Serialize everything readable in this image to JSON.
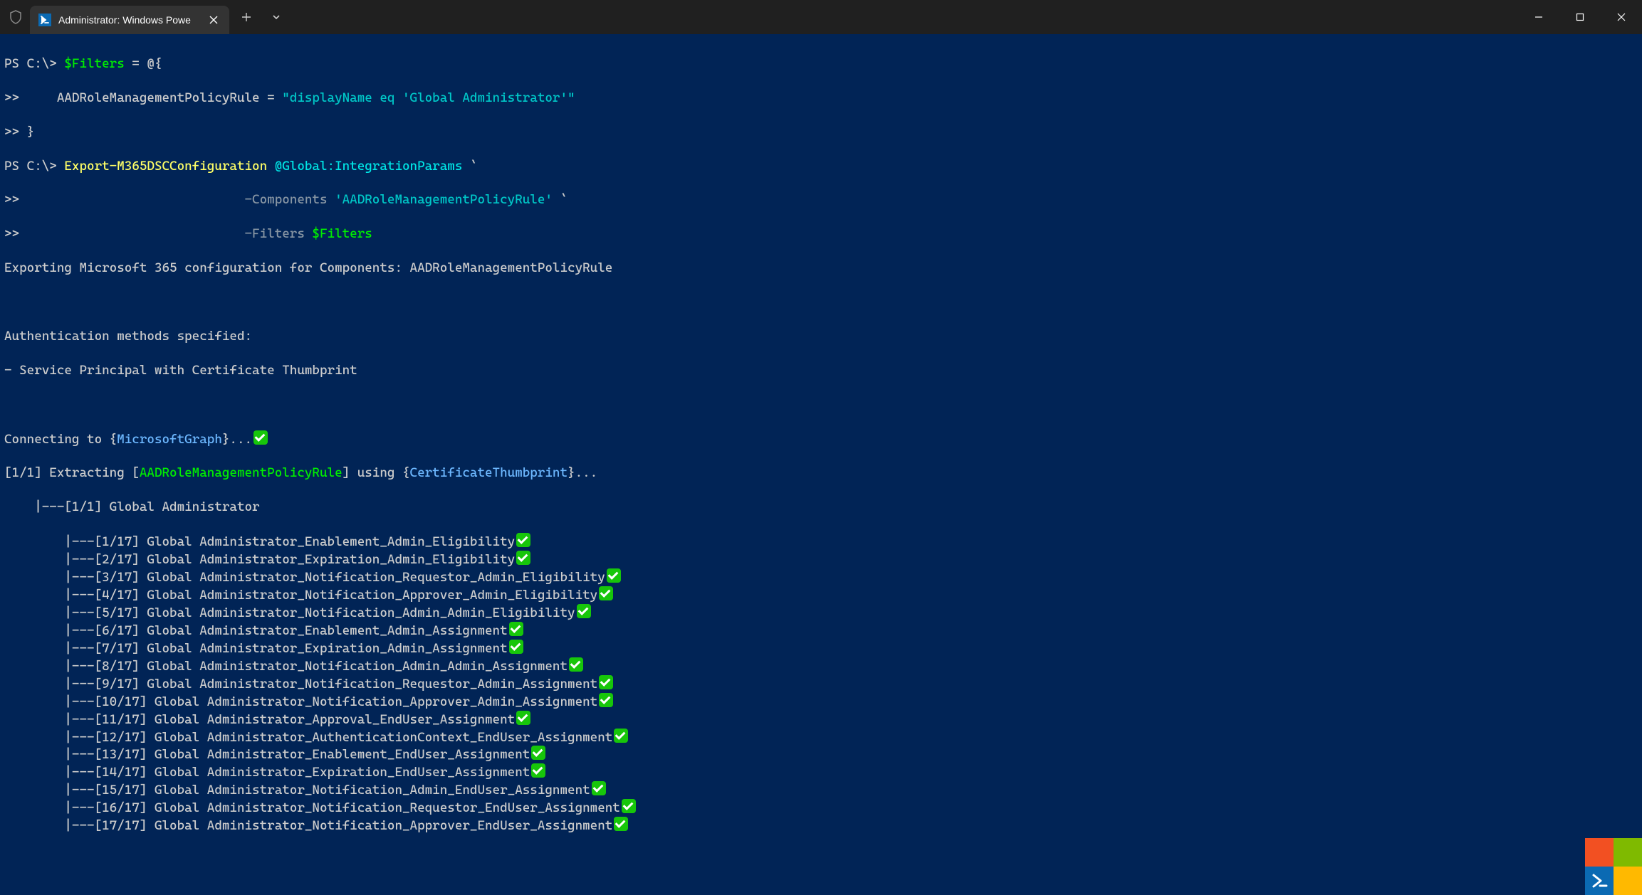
{
  "window": {
    "tab_title": "Administrator: Windows Powe",
    "shield_icon": "shield",
    "ps_icon": ">_"
  },
  "cmd": {
    "p1_prompt": "PS C:\\> ",
    "p1_var": "$Filters",
    "p1_rest": " = @{",
    "p2_prefix": ">>     ",
    "p2_key": "AADRoleManagementPolicyRule",
    "p2_eq": " = ",
    "p2_val": "\"displayName eq 'Global Administrator'\"",
    "p3": ">> }",
    "p4_prompt": "PS C:\\> ",
    "p4_cmd": "Export-M365DSCConfiguration",
    "p4_splat": " @Global:IntegrationParams",
    "p4_tick": " `",
    "p5_prefix": ">>                              ",
    "p5_param": "-Components",
    "p5_val": " 'AADRoleManagementPolicyRule'",
    "p5_tick": " `",
    "p6_prefix": ">>                              ",
    "p6_param": "-Filters",
    "p6_var": " $Filters"
  },
  "out": {
    "l1": "Exporting Microsoft 365 configuration for Components: AADRoleManagementPolicyRule",
    "l2": "Authentication methods specified:",
    "l3": "- Service Principal with Certificate Thumbprint",
    "conn_pre": "Connecting to {",
    "conn_svc": "MicrosoftGraph",
    "conn_post": "}...",
    "ext_1": "[1/1] Extracting [",
    "ext_comp": "AADRoleManagementPolicyRule",
    "ext_2": "] using {",
    "ext_auth": "CertificateThumbprint",
    "ext_3": "}...",
    "role_line": "    |---[1/1] Global Administrator",
    "rules": [
      "        |---[1/17] Global Administrator_Enablement_Admin_Eligibility",
      "        |---[2/17] Global Administrator_Expiration_Admin_Eligibility",
      "        |---[3/17] Global Administrator_Notification_Requestor_Admin_Eligibility",
      "        |---[4/17] Global Administrator_Notification_Approver_Admin_Eligibility",
      "        |---[5/17] Global Administrator_Notification_Admin_Admin_Eligibility",
      "        |---[6/17] Global Administrator_Enablement_Admin_Assignment",
      "        |---[7/17] Global Administrator_Expiration_Admin_Assignment",
      "        |---[8/17] Global Administrator_Notification_Admin_Admin_Assignment",
      "        |---[9/17] Global Administrator_Notification_Requestor_Admin_Assignment",
      "        |---[10/17] Global Administrator_Notification_Approver_Admin_Assignment",
      "        |---[11/17] Global Administrator_Approval_EndUser_Assignment",
      "        |---[12/17] Global Administrator_AuthenticationContext_EndUser_Assignment",
      "        |---[13/17] Global Administrator_Enablement_EndUser_Assignment",
      "        |---[14/17] Global Administrator_Expiration_EndUser_Assignment",
      "        |---[15/17] Global Administrator_Notification_Admin_EndUser_Assignment",
      "        |---[16/17] Global Administrator_Notification_Requestor_EndUser_Assignment",
      "        |---[17/17] Global Administrator_Notification_Approver_EndUser_Assignment"
    ]
  }
}
